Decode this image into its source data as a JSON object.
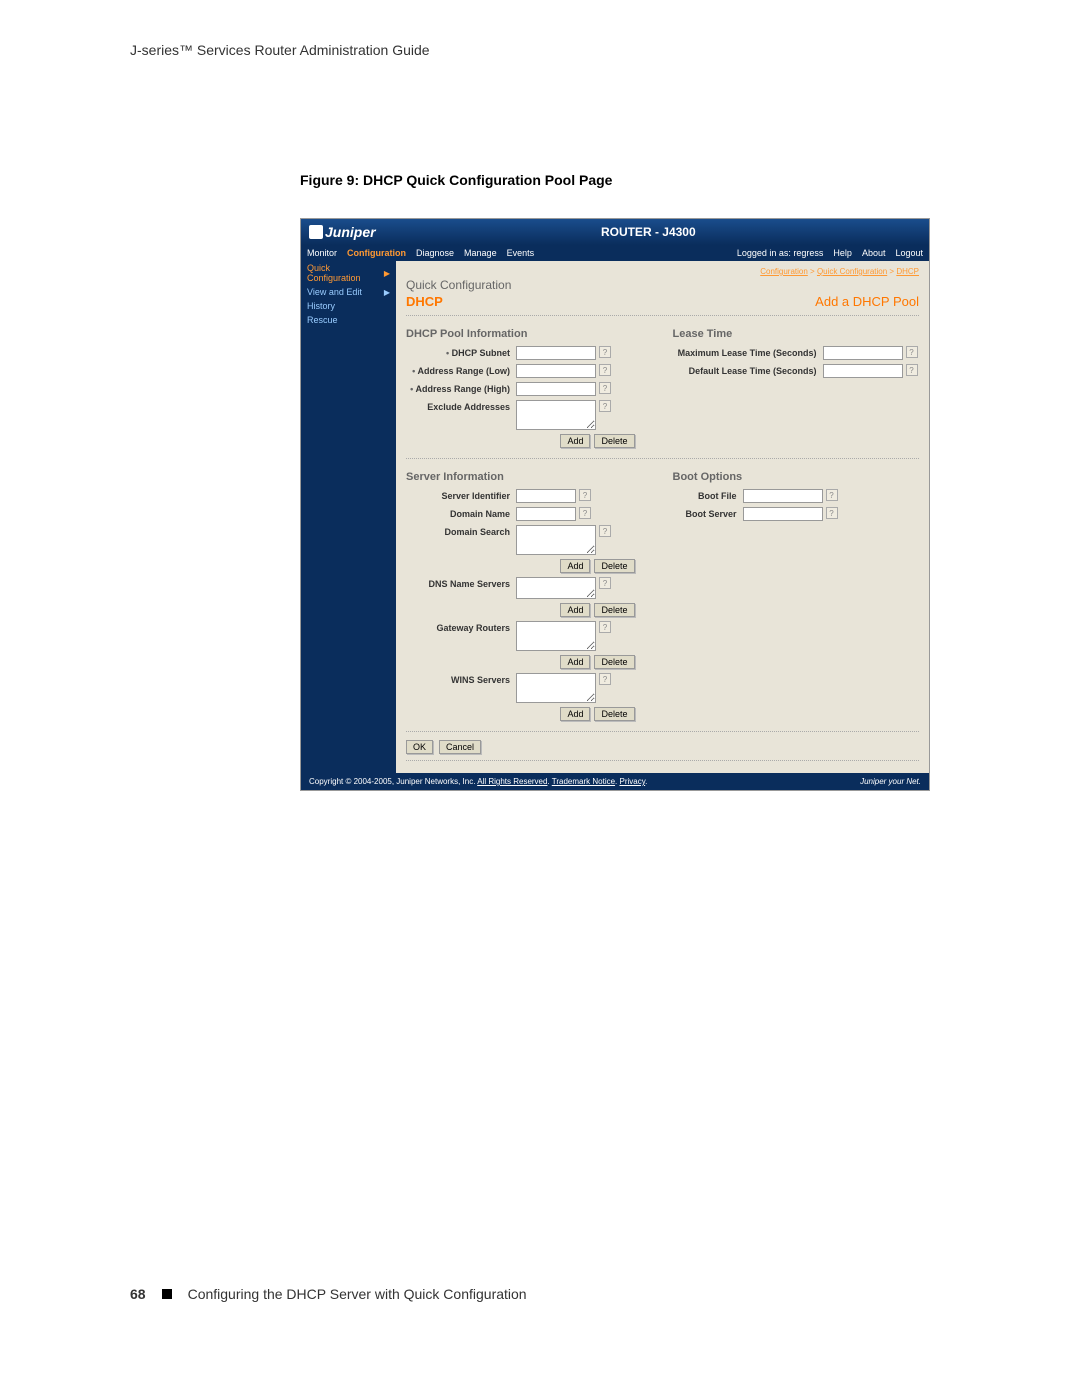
{
  "doc": {
    "header": "J-series™ Services Router Administration Guide",
    "figure_title": "Figure 9: DHCP Quick Configuration Pool Page",
    "page_number": "68",
    "chapter": "Configuring the DHCP Server with Quick Configuration"
  },
  "ui": {
    "logo": "Juniper",
    "router": "ROUTER - J4300",
    "nav": {
      "monitor": "Monitor",
      "configuration": "Configuration",
      "diagnose": "Diagnose",
      "manage": "Manage",
      "events": "Events",
      "logged_in": "Logged in as: regress",
      "help": "Help",
      "about": "About",
      "logout": "Logout"
    },
    "breadcrumb": {
      "a": "Configuration",
      "b": "Quick Configuration",
      "c": "DHCP"
    },
    "sidebar": {
      "quick_config": "Quick Configuration",
      "view_edit": "View and Edit",
      "history": "History",
      "rescue": "Rescue"
    },
    "content": {
      "qc_title": "Quick Configuration",
      "dhcp": "DHCP",
      "add_pool": "Add a DHCP Pool",
      "pool_info": "DHCP Pool Information",
      "lease_time": "Lease Time",
      "server_info": "Server Information",
      "boot_options": "Boot Options",
      "labels": {
        "dhcp_subnet": "DHCP Subnet",
        "addr_low": "Address Range (Low)",
        "addr_high": "Address Range (High)",
        "exclude": "Exclude Addresses",
        "max_lease": "Maximum Lease Time (Seconds)",
        "def_lease": "Default Lease Time (Seconds)",
        "server_id": "Server Identifier",
        "domain_name": "Domain Name",
        "domain_search": "Domain Search",
        "dns_servers": "DNS Name Servers",
        "gateway": "Gateway Routers",
        "wins": "WINS Servers",
        "boot_file": "Boot File",
        "boot_server": "Boot Server"
      },
      "buttons": {
        "add": "Add",
        "delete": "Delete",
        "ok": "OK",
        "cancel": "Cancel"
      }
    },
    "footer": {
      "copyright": "Copyright © 2004-2005, Juniper Networks, Inc.",
      "rights": "All Rights Reserved",
      "trademark": "Trademark Notice",
      "privacy": "Privacy",
      "brand": "Juniper your Net."
    }
  }
}
